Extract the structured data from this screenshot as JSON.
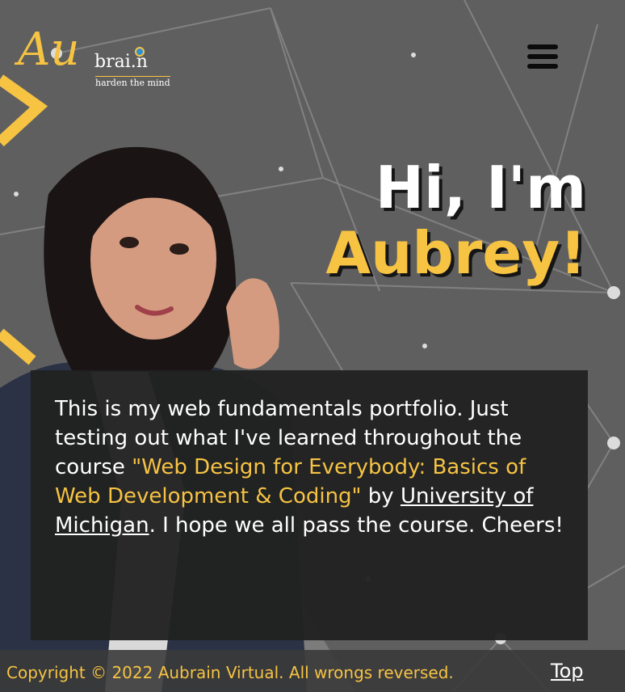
{
  "colors": {
    "accent": "#f6c343",
    "background": "#5f5f5f",
    "panel": "#212121",
    "text": "#ffffff"
  },
  "logo": {
    "script_part": "Au",
    "word_part": "brai.n",
    "tagline": "harden the mind"
  },
  "nav": {
    "menu_icon": "hamburger-icon"
  },
  "hero": {
    "line1": "Hi, I'm",
    "line2": "Aubrey!"
  },
  "intro": {
    "text_before": "This is my web fundamentals portfolio. Just testing out what I've learned throughout the course ",
    "course_title": "\"Web Design for Everybody: Basics of Web Development & Coding\"",
    "text_by": " by ",
    "university_link": "University of Michigan",
    "text_after": ". I hope we all pass the course. Cheers!"
  },
  "footer": {
    "copyright": "Copyright © 2022 Aubrain Virtual. All wrongs reversed.",
    "top_link": "Top"
  }
}
